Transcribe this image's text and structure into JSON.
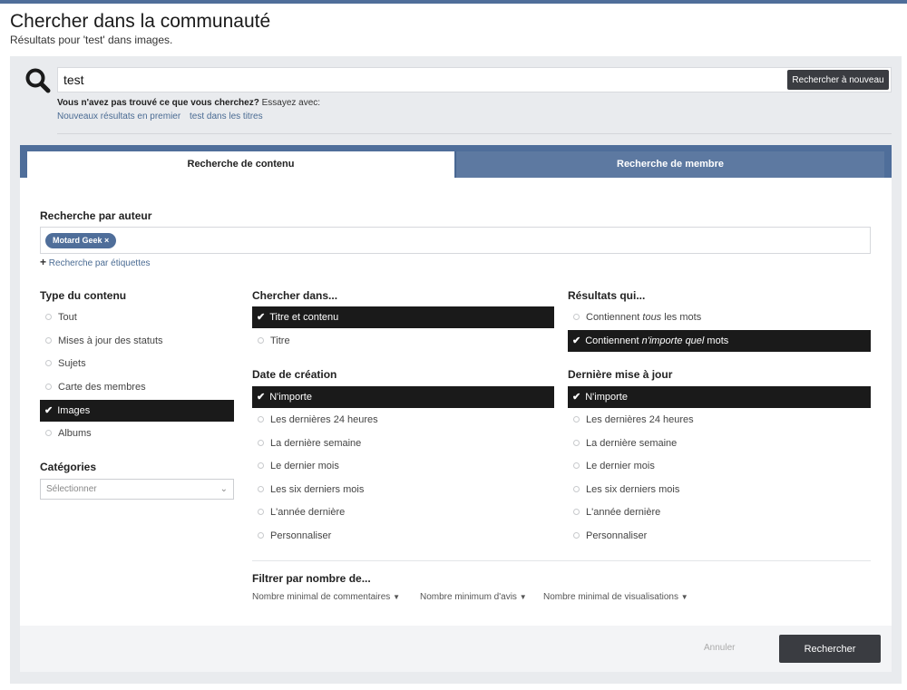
{
  "header": {
    "title": "Chercher dans la communauté",
    "subtitle": "Résultats pour 'test' dans images."
  },
  "search": {
    "query": "test",
    "research_label": "Rechercher à nouveau",
    "notfound_bold": "Vous n'avez pas trouvé ce que vous cherchez?",
    "notfound_rest": " Essayez avec:",
    "suggestions": [
      "Nouveaux résultats en premier",
      "test dans les titres"
    ]
  },
  "tabs": [
    "Recherche de contenu",
    "Recherche de membre"
  ],
  "author": {
    "label": "Recherche par auteur",
    "tag": "Motard Geek",
    "tag_remove": "×",
    "add_tags": "Recherche par étiquettes"
  },
  "content_type": {
    "label": "Type du contenu",
    "options": [
      "Tout",
      "Mises à jour des statuts",
      "Sujets",
      "Carte des membres",
      "Images",
      "Albums"
    ],
    "selected": "Images"
  },
  "categories": {
    "label": "Catégories",
    "placeholder": "Sélectionner"
  },
  "search_in": {
    "label": "Chercher dans...",
    "options": [
      "Titre et contenu",
      "Titre"
    ],
    "selected": "Titre et contenu"
  },
  "results_with": {
    "label": "Résultats qui...",
    "options": [
      {
        "pre": "Contiennent ",
        "em": "tous",
        "post": " les mots"
      },
      {
        "pre": "Contiennent ",
        "em": "n'importe quel",
        "post": " mots"
      }
    ],
    "selected_index": 1
  },
  "created": {
    "label": "Date de création",
    "options": [
      "N'importe",
      "Les dernières 24 heures",
      "La dernière semaine",
      "Le dernier mois",
      "Les six derniers mois",
      "L'année dernière",
      "Personnaliser"
    ],
    "selected": "N'importe"
  },
  "updated": {
    "label": "Dernière mise à jour",
    "options": [
      "N'importe",
      "Les dernières 24 heures",
      "La dernière semaine",
      "Le dernier mois",
      "Les six derniers mois",
      "L'année dernière",
      "Personnaliser"
    ],
    "selected": "N'importe"
  },
  "filter": {
    "label": "Filtrer par nombre de...",
    "links": [
      "Nombre minimal de commentaires",
      "Nombre minimum d'avis",
      "Nombre minimal de visualisations"
    ]
  },
  "footer": {
    "cancel": "Annuler",
    "submit": "Rechercher"
  },
  "icons": {
    "search": "search-icon",
    "check": "check-icon",
    "chevron": "chevron-down-icon",
    "caret": "caret-down-icon",
    "plus": "plus-icon"
  }
}
